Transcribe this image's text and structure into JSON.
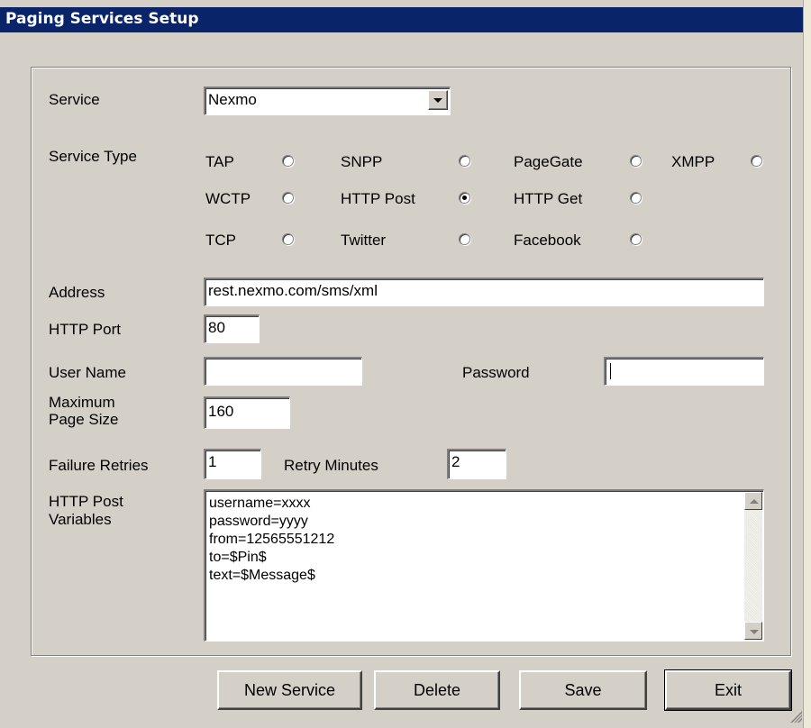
{
  "window": {
    "title": "Paging Services Setup"
  },
  "labels": {
    "service": "Service",
    "service_type": "Service Type",
    "address": "Address",
    "http_port": "HTTP Port",
    "user_name": "User Name",
    "password": "Password",
    "max_page_size": "Maximum\nPage Size",
    "failure_retries": "Failure Retries",
    "retry_minutes": "Retry Minutes",
    "http_post_variables": "HTTP Post\nVariables"
  },
  "fields": {
    "service": "Nexmo",
    "address": "rest.nexmo.com/sms/xml",
    "http_port": "80",
    "user_name": "",
    "password": "",
    "max_page_size": "160",
    "failure_retries": "1",
    "retry_minutes": "2",
    "post_variables": [
      "username=xxxx",
      "password=yyyy",
      "from=12565551212",
      "to=$Pin$",
      "text=$Message$"
    ]
  },
  "service_types": [
    {
      "label": "TAP",
      "checked": false
    },
    {
      "label": "SNPP",
      "checked": false
    },
    {
      "label": "PageGate",
      "checked": false
    },
    {
      "label": "XMPP",
      "checked": false
    },
    {
      "label": "WCTP",
      "checked": false
    },
    {
      "label": "HTTP Post",
      "checked": true
    },
    {
      "label": "HTTP Get",
      "checked": false
    },
    {
      "label": "TCP",
      "checked": false
    },
    {
      "label": "Twitter",
      "checked": false
    },
    {
      "label": "Facebook",
      "checked": false
    }
  ],
  "buttons": {
    "new_service": "New Service",
    "delete": "Delete",
    "save": "Save",
    "exit": "Exit"
  }
}
